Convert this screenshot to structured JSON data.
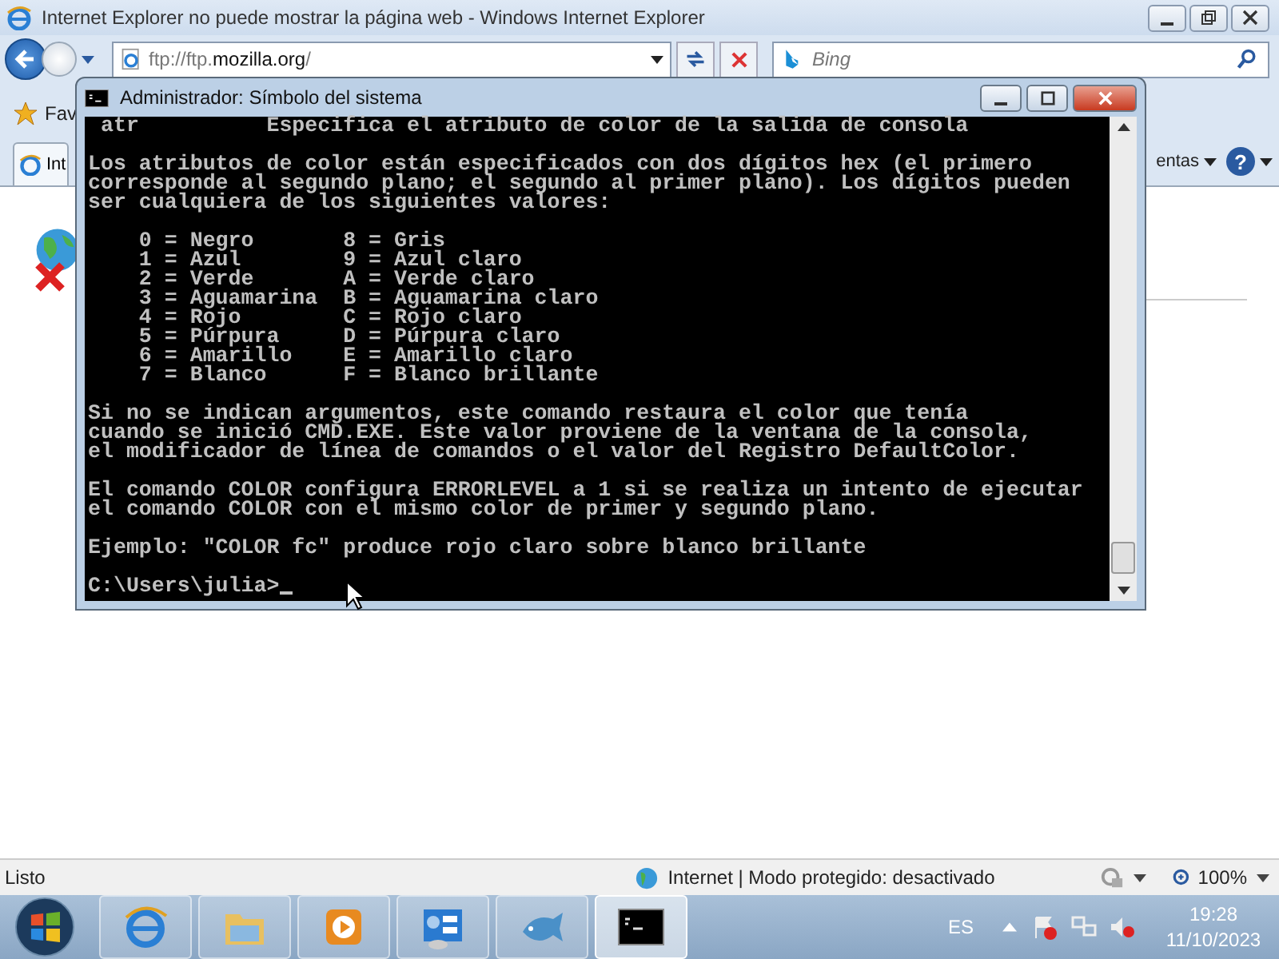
{
  "ie_window": {
    "title": "Internet Explorer no puede mostrar la página web - Windows Internet Explorer",
    "address": {
      "prefix": "ftp://ftp.",
      "domain": "mozilla.org",
      "suffix": "/"
    },
    "search_placeholder": "Bing",
    "favorites_label": "Fav",
    "tab_label": "Int",
    "tools_label": "entas",
    "help_label": "?"
  },
  "console": {
    "title": "Administrador: Símbolo del sistema",
    "paragraphs": [
      [
        " atr          Especifica el atributo de color de la salida de consola"
      ],
      [
        "Los atributos de color están especificados con dos dígitos hex (el primero",
        "corresponde al segundo plano; el segundo al primer plano). Los dígitos pueden",
        "ser cualquiera de los siguientes valores:"
      ],
      [
        "    0 = Negro       8 = Gris",
        "    1 = Azul        9 = Azul claro",
        "    2 = Verde       A = Verde claro",
        "    3 = Aguamarina  B = Aguamarina claro",
        "    4 = Rojo        C = Rojo claro",
        "    5 = Púrpura     D = Púrpura claro",
        "    6 = Amarillo    E = Amarillo claro",
        "    7 = Blanco      F = Blanco brillante"
      ],
      [
        "Si no se indican argumentos, este comando restaura el color que tenía",
        "cuando se inició CMD.EXE. Este valor proviene de la ventana de la consola,",
        "el modificador de línea de comandos o el valor del Registro DefaultColor."
      ],
      [
        "El comando COLOR configura ERRORLEVEL a 1 si se realiza un intento de ejecutar",
        "el comando COLOR con el mismo color de primer y segundo plano."
      ],
      [
        "Ejemplo: \"COLOR fc\" produce rojo claro sobre blanco brillante"
      ]
    ],
    "prompt": "C:\\Users\\julia>"
  },
  "status_bar": {
    "status": "Listo",
    "zone": "Internet | Modo protegido: desactivado",
    "zoom": "100%"
  },
  "taskbar": {
    "apps": [
      {
        "kind": "ie",
        "selected": false
      },
      {
        "kind": "folder",
        "selected": false
      },
      {
        "kind": "media",
        "selected": false
      },
      {
        "kind": "panel",
        "selected": false
      },
      {
        "kind": "fish",
        "selected": false
      },
      {
        "kind": "cmd",
        "selected": true
      }
    ],
    "language": "ES",
    "time": "19:28",
    "date": "11/10/2023"
  }
}
